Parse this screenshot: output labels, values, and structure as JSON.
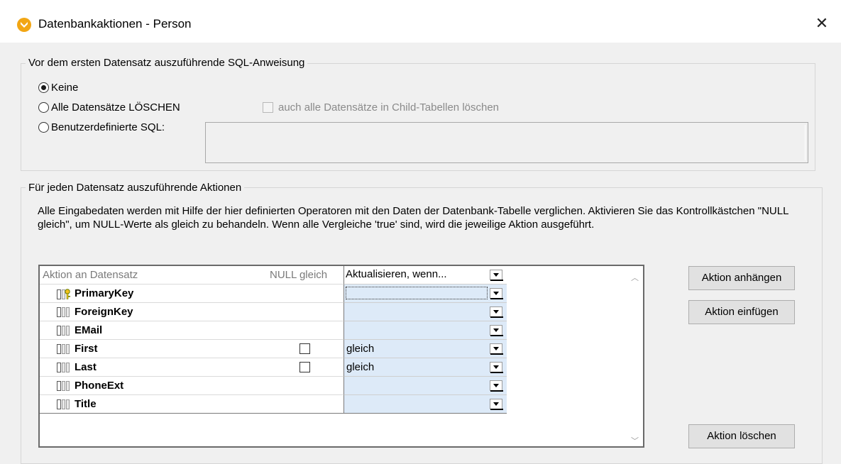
{
  "window": {
    "title": "Datenbankaktionen - Person",
    "close_glyph": "✕"
  },
  "before_group": {
    "legend": "Vor dem ersten Datensatz auszuführende SQL-Anweisung",
    "options": [
      {
        "label": "Keine",
        "selected": true
      },
      {
        "label": "Alle Datensätze LÖSCHEN",
        "selected": false
      },
      {
        "label": "Benutzerdefinierte SQL:",
        "selected": false
      }
    ],
    "child_delete_label": "auch alle Datensätze in Child-Tabellen löschen",
    "custom_sql_value": ""
  },
  "per_record_group": {
    "legend": "Für jeden Datensatz auszuführende Aktionen",
    "description": "Alle Eingabedaten werden mit Hilfe der hier definierten Operatoren mit den Daten der Datenbank-Tabelle verglichen. Aktivieren Sie das Kontrollkästchen \"NULL gleich\", um NULL-Werte als gleich zu behandeln. Wenn alle Vergleiche 'true' sind, wird die jeweilige Aktion ausgeführt."
  },
  "table": {
    "header_action": "Aktion an Datensatz",
    "header_null": "NULL gleich",
    "header_update": "Aktualisieren, wenn...",
    "rows": [
      {
        "name": "PrimaryKey",
        "icon": "primary-key-column-icon",
        "null_equal": null,
        "op": ""
      },
      {
        "name": "ForeignKey",
        "icon": "column-icon",
        "null_equal": null,
        "op": ""
      },
      {
        "name": "EMail",
        "icon": "column-icon",
        "null_equal": null,
        "op": ""
      },
      {
        "name": "First",
        "icon": "column-icon",
        "null_equal": false,
        "op": "gleich"
      },
      {
        "name": "Last",
        "icon": "column-icon",
        "null_equal": false,
        "op": "gleich"
      },
      {
        "name": "PhoneExt",
        "icon": "column-icon",
        "null_equal": null,
        "op": ""
      },
      {
        "name": "Title",
        "icon": "column-icon",
        "null_equal": null,
        "op": ""
      }
    ]
  },
  "buttons": {
    "append": "Aktion anhängen",
    "insert": "Aktion einfügen",
    "delete": "Aktion löschen"
  },
  "colors": {
    "title_icon": "#f2a614",
    "op_cell_bg": "#ddeaf8"
  }
}
